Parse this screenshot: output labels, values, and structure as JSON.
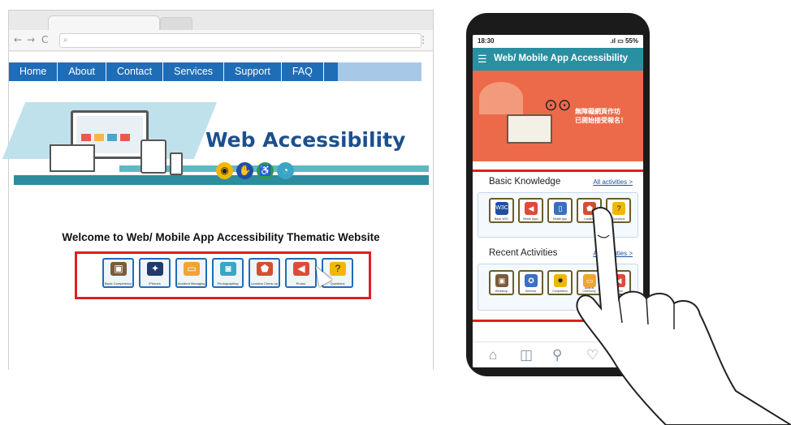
{
  "browser": {
    "nav_back": "←",
    "nav_forward": "→",
    "nav_reload": "C",
    "omnibox_icon": "⌕",
    "menu_icon": "⋮"
  },
  "site": {
    "nav": [
      "Home",
      "About",
      "Contact",
      "Services",
      "Support",
      "FAQ"
    ],
    "brand": "Web Accessibility",
    "welcome": "Welcome to Web/ Mobile App Accessibility Thematic Website",
    "tiles": [
      "Basic Competency",
      "iPhones",
      "Accident Managing",
      "Photographing",
      "Location Check-up",
      "Promo",
      "Questions"
    ]
  },
  "phone": {
    "time": "18:30",
    "status_right": ".ıl ▭ 55%",
    "title": "Web/ Mobile App Accessibility",
    "banner_text": "無障礙網頁作坊\n已開始接受報名！",
    "basic": {
      "heading": "Basic Knowledge",
      "link": "All activities >",
      "tiles": [
        "Basic W3C",
        "Whole Apps",
        "Mobile App",
        "Location",
        "Questions"
      ]
    },
    "recent": {
      "heading": "Recent Activities",
      "link": "All activities >",
      "tiles": [
        "Workshop",
        "Seminar",
        "Competition",
        "Awards Ceremony",
        "Promo"
      ]
    }
  },
  "colors": {
    "nav_blue": "#1f6db7",
    "teal": "#2a8fa1",
    "highlight_red": "#e01e24",
    "banner_orange": "#ec6a4a"
  }
}
